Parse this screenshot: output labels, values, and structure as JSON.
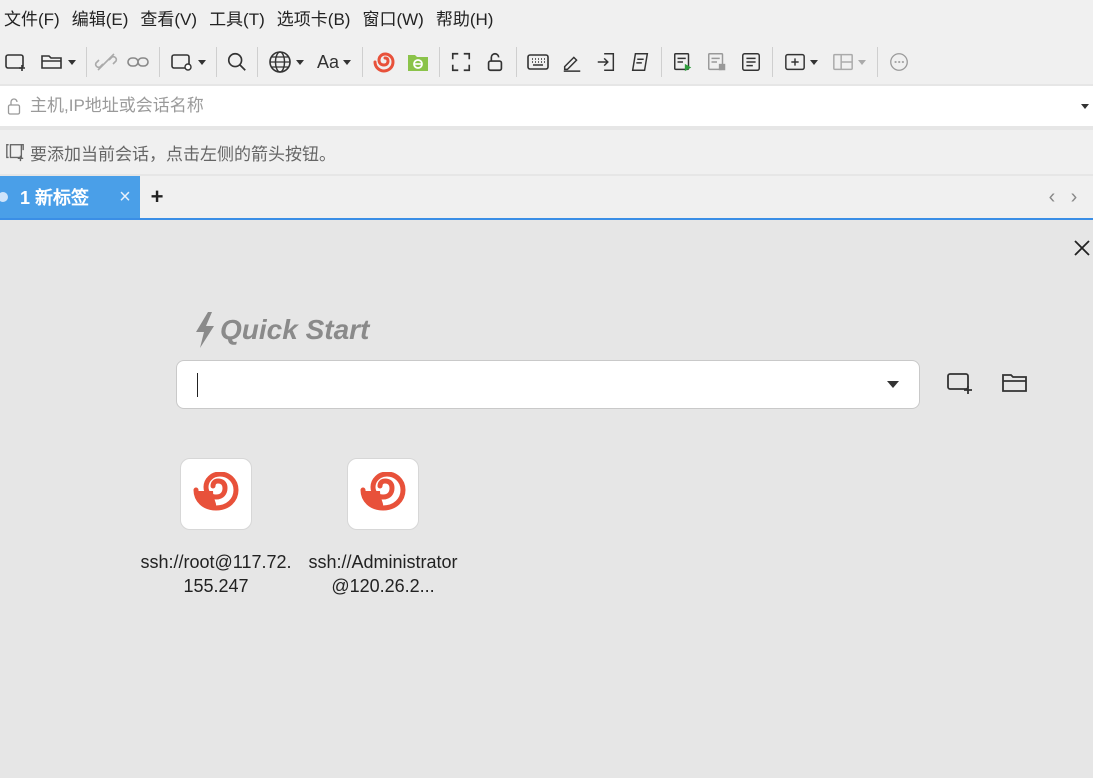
{
  "menu": [
    "文件(F)",
    "编辑(E)",
    "查看(V)",
    "工具(T)",
    "选项卡(B)",
    "窗口(W)",
    "帮助(H)"
  ],
  "toolbar": {
    "icons": [
      "new-session-icon",
      "open-session-icon",
      "disconnect-icon",
      "reconnect-icon",
      "new-window-icon",
      "search-icon",
      "globe-icon",
      "font-icon",
      "xshell-icon",
      "xftp-icon",
      "fullscreen-icon",
      "lock-icon",
      "keyboard-icon",
      "compose-icon",
      "transfer-icon",
      "script-icon",
      "start-log-icon",
      "stop-log-icon",
      "notes-icon",
      "add-tab-group-icon",
      "layout-icon",
      "chat-icon"
    ]
  },
  "address": {
    "placeholder": "主机,IP地址或会话名称"
  },
  "hint": {
    "text": "要添加当前会话，点击左侧的箭头按钮。"
  },
  "tabs": {
    "active_label": "1 新标签",
    "close_glyph": "×",
    "add_glyph": "+",
    "prev_glyph": "‹",
    "next_glyph": "›"
  },
  "quick_start": {
    "title": "Quick Start",
    "input_value": "",
    "sessions": [
      {
        "label": "ssh://root@117.72.155.247"
      },
      {
        "label": "ssh://Administrator@120.26.2..."
      }
    ]
  },
  "colors": {
    "tab_active": "#4a9fe8",
    "tab_underline": "#3a8ee6",
    "xshell_red": "#e8513a",
    "xftp_green": "#8bc34a",
    "panel_bg": "#e6e6e6",
    "chrome_bg": "#f0f0f0"
  }
}
